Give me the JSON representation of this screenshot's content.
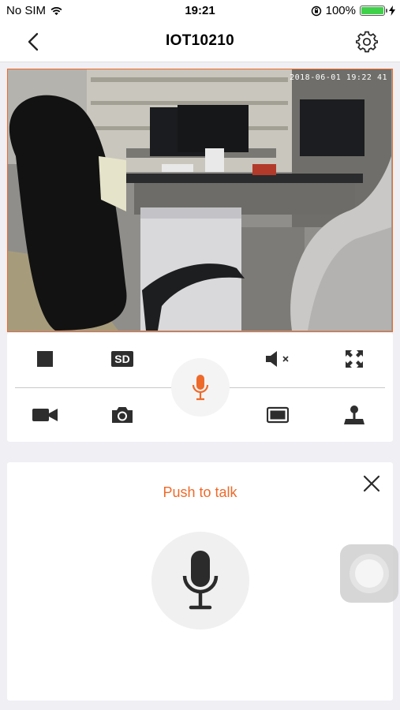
{
  "status_bar": {
    "carrier": "No SIM",
    "time": "19:21",
    "battery_percent": "100%",
    "battery_level": 1.0,
    "battery_color": "#3fd14a"
  },
  "nav": {
    "title": "IOT10210",
    "back_icon": "chevron-left-icon",
    "settings_icon": "gear-icon"
  },
  "video": {
    "timestamp": "2018-06-01 19:22 41",
    "border_color": "#ee6a2a"
  },
  "controls": {
    "row1": [
      {
        "name": "stop",
        "icon": "stop-icon"
      },
      {
        "name": "quality",
        "label": "SD"
      },
      {
        "name": "mute",
        "icon": "speaker-mute-icon"
      },
      {
        "name": "fullscreen",
        "icon": "fullscreen-icon"
      }
    ],
    "row2": [
      {
        "name": "record",
        "icon": "video-camera-icon"
      },
      {
        "name": "snapshot",
        "icon": "camera-icon"
      },
      {
        "name": "screen",
        "icon": "screen-icon"
      },
      {
        "name": "ptz",
        "icon": "joystick-icon"
      }
    ],
    "talk_icon": "microphone-icon",
    "accent": "#ee6a2a"
  },
  "talk_panel": {
    "label": "Push to talk",
    "close_icon": "close-icon",
    "mic_icon": "microphone-icon"
  }
}
